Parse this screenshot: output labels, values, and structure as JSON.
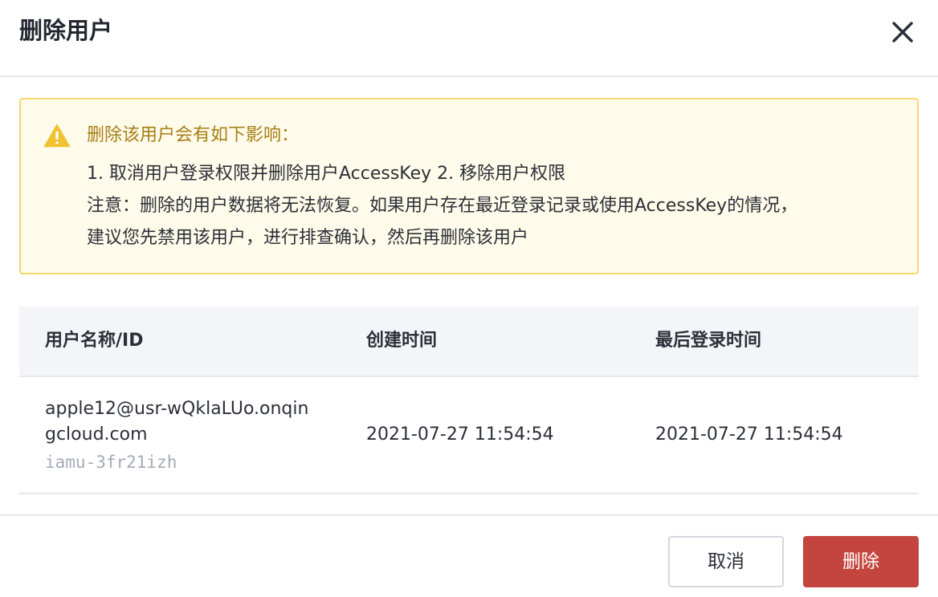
{
  "dialog": {
    "title": "删除用户",
    "close_icon": "close-icon"
  },
  "alert": {
    "icon": "warning-triangle-icon",
    "color": "#f0c230",
    "title": "删除该用户会有如下影响：",
    "lines": [
      "1. 取消用户登录权限并删除用户AccessKey 2. 移除用户权限",
      "注意：删除的用户数据将无法恢复。如果用户存在最近登录记录或使用AccessKey的情况，",
      "建议您先禁用该用户，进行排查确认，然后再删除该用户"
    ]
  },
  "table": {
    "columns": [
      "用户名称/ID",
      "创建时间",
      "最后登录时间"
    ],
    "rows": [
      {
        "name": "apple12@usr-wQklaLUo.onqingcloud.com",
        "id": "iamu-3fr21izh",
        "created": "2021-07-27 11:54:54",
        "last_login": "2021-07-27 11:54:54"
      }
    ]
  },
  "footer": {
    "cancel_label": "取消",
    "delete_label": "删除",
    "delete_color": "#c4453e"
  }
}
